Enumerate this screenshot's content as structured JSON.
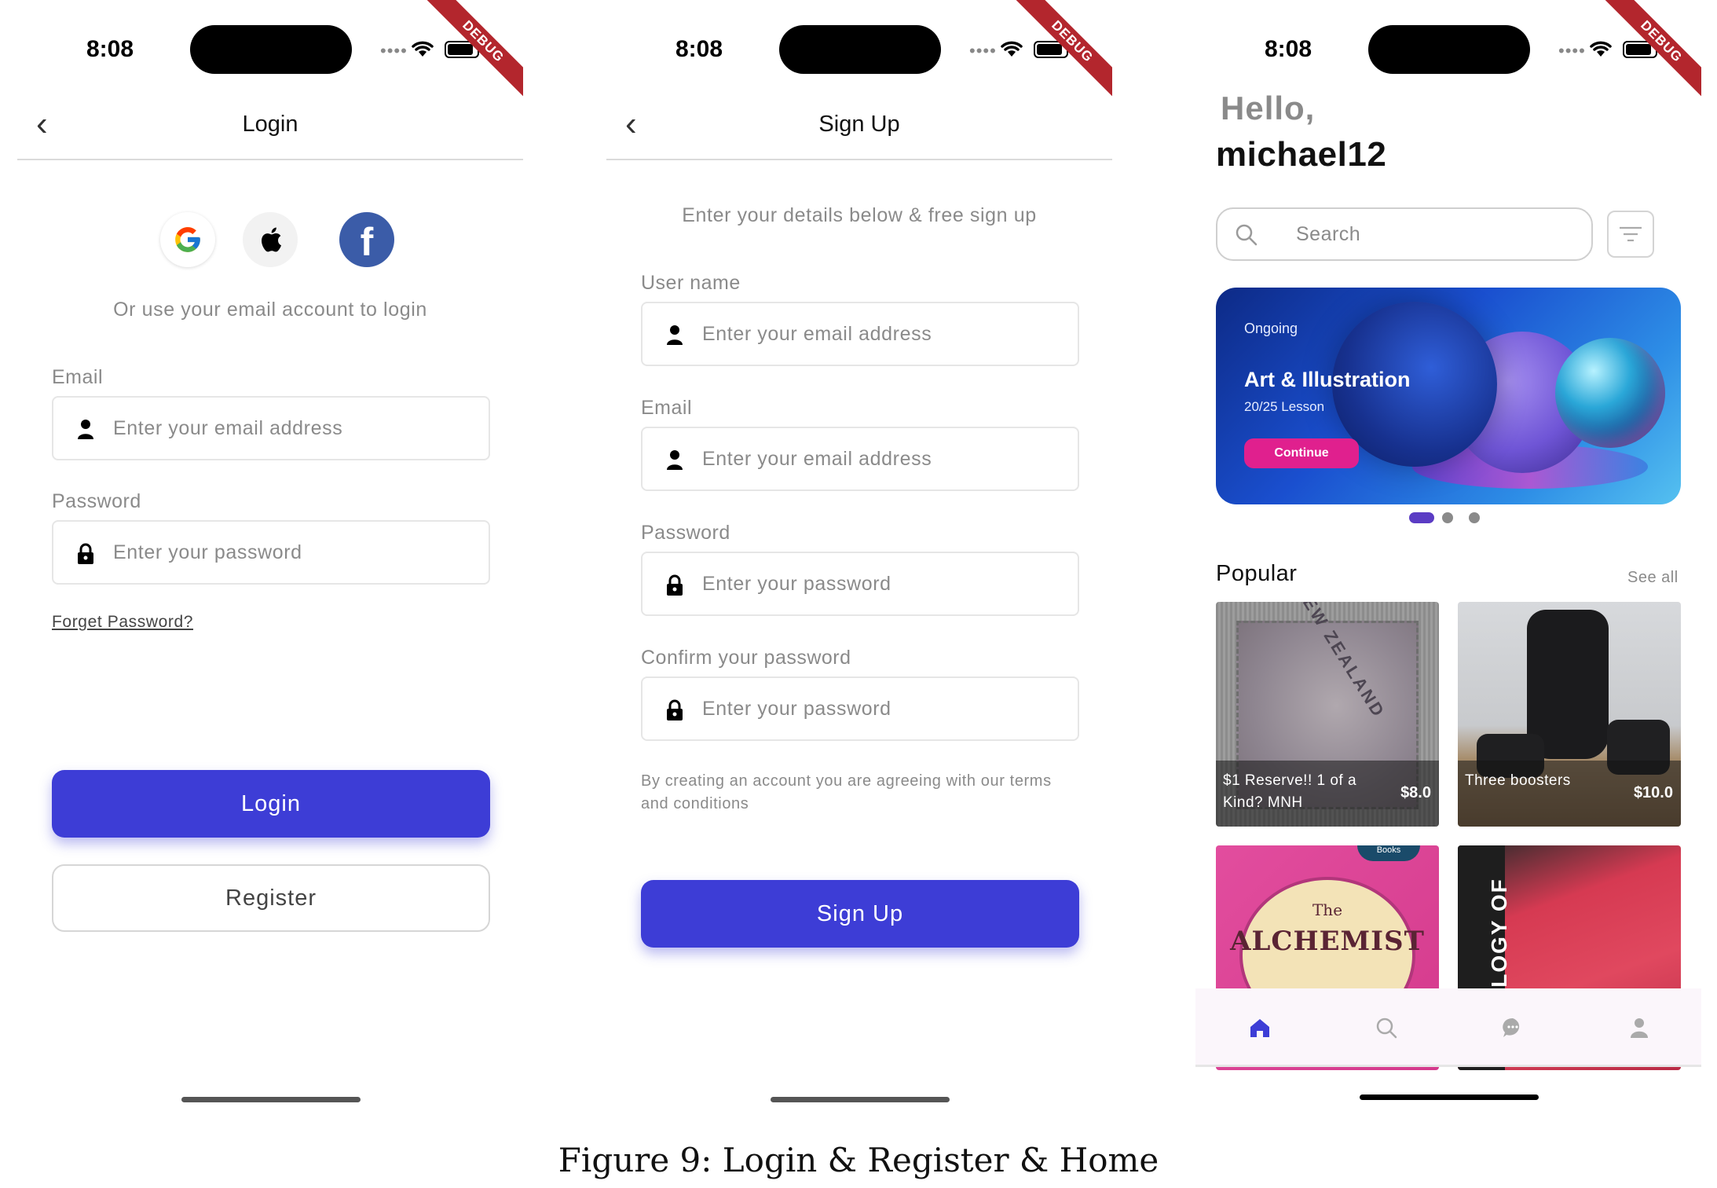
{
  "status": {
    "time": "8:08",
    "debug": "DEBUG"
  },
  "login": {
    "title": "Login",
    "hint": "Or use your email account to login",
    "email_label": "Email",
    "email_placeholder": "Enter your email address",
    "password_label": "Password",
    "password_placeholder": "Enter your password",
    "forget": "Forget Password?",
    "login_button": "Login",
    "register_button": "Register",
    "social_icons": [
      "google-icon",
      "apple-icon",
      "facebook-icon"
    ]
  },
  "signup": {
    "title": "Sign Up",
    "subtitle": "Enter your details below & free sign up",
    "username_label": "User name",
    "username_placeholder": "Enter your email address",
    "email_label": "Email",
    "email_placeholder": "Enter your email address",
    "password_label": "Password",
    "password_placeholder": "Enter your password",
    "confirm_label": "Confirm your password",
    "confirm_placeholder": "Enter your password",
    "terms": "By creating an account you are agreeing with our terms and conditions",
    "signup_button": "Sign Up"
  },
  "home": {
    "greeting": "Hello,",
    "username": "michael12",
    "search_placeholder": "Search",
    "banner": {
      "status": "Ongoing",
      "title": "Art & Illustration",
      "progress": "20/25 Lesson",
      "button": "Continue",
      "page_count": 3,
      "active_page": 0
    },
    "popular_title": "Popular",
    "see_all": "See all",
    "items": [
      {
        "name": "$1 Reserve!! 1 of a Kind? MNH",
        "price": "$8.0",
        "image": "stamp"
      },
      {
        "name": "Three boosters",
        "price": "$10.0",
        "image": "booster-seats"
      },
      {
        "name": "",
        "price": "",
        "image": "the-alchemist-book",
        "cover_title": "ALCHEMIST",
        "cover_the": "The",
        "cover_badge": "Books"
      },
      {
        "name": "",
        "price": "",
        "image": "red-book",
        "spine_text": "HOLOGY OF"
      }
    ],
    "stamp_text": "NEW ZEALAND",
    "tabs": [
      "home-icon",
      "search-icon",
      "chat-icon",
      "profile-icon"
    ],
    "active_tab": 0,
    "accent": "#3d3dd6"
  },
  "caption": "Figure 9: Login & Register & Home"
}
